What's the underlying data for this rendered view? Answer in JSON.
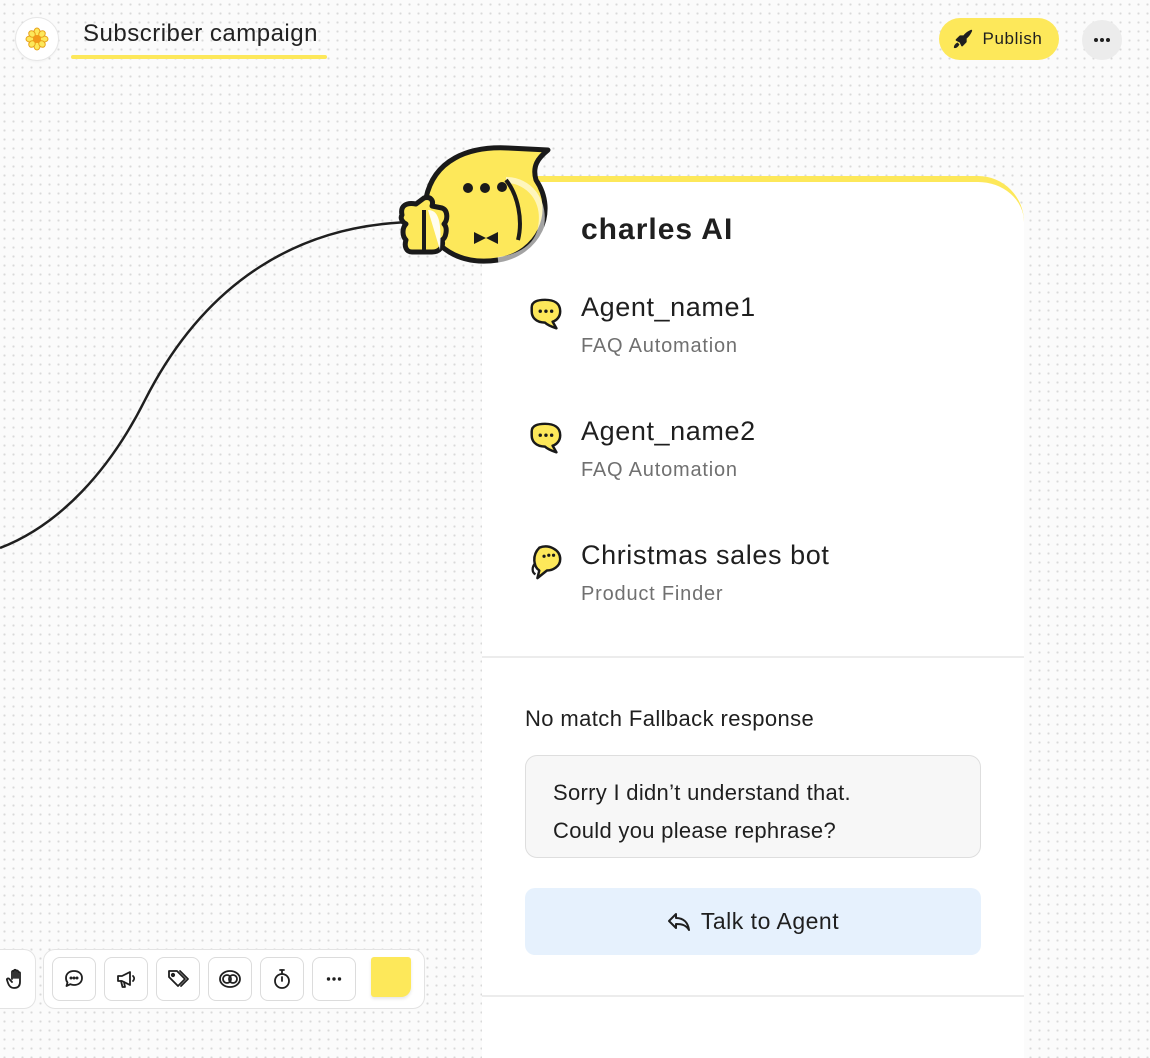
{
  "header": {
    "title": "Subscriber campaign",
    "publish_label": "Publish",
    "logo_icon": "flower-icon",
    "more_icon": "more-horizontal-icon"
  },
  "card": {
    "title": "charles AI",
    "agents": [
      {
        "name": "Agent_name1",
        "subtitle": "FAQ Automation",
        "icon": "chat-bubble-icon"
      },
      {
        "name": "Agent_name2",
        "subtitle": "FAQ Automation",
        "icon": "chat-bubble-icon"
      },
      {
        "name": "Christmas sales bot",
        "subtitle": "Product Finder",
        "icon": "bot-bubble-icon"
      }
    ],
    "fallback": {
      "label": "No match Fallback response",
      "line1": "Sorry I didn’t understand that.",
      "line2": "Could you please rephrase?"
    },
    "talk_button": "Talk to Agent"
  },
  "toolbar": {
    "tools": [
      "message-icon",
      "megaphone-icon",
      "tags-icon",
      "ai-brain-icon",
      "timer-icon",
      "more-horizontal-icon",
      "sticky-note-icon"
    ]
  },
  "colors": {
    "accent": "#fde85a",
    "talk_button_bg": "#e6f1fd",
    "canvas_bg": "#fbfbfb"
  }
}
